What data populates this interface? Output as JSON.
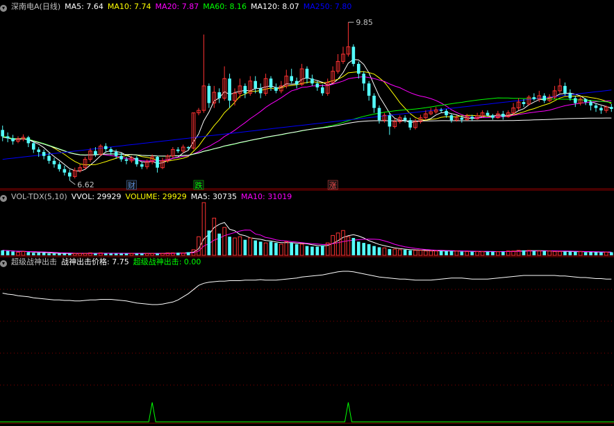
{
  "main_legend": {
    "title": "深南电A(日线)",
    "items": [
      {
        "text": "MA5: 7.64",
        "color": "#ffffff"
      },
      {
        "text": "MA10: 7.74",
        "color": "#ffff00"
      },
      {
        "text": "MA20: 7.87",
        "color": "#ff00ff"
      },
      {
        "text": "MA60: 8.16",
        "color": "#00ff00"
      },
      {
        "text": "MA120: 8.07",
        "color": "#ffffff"
      },
      {
        "text": "MA250: 7.80",
        "color": "#0000ff"
      }
    ]
  },
  "vol_legend": {
    "items": [
      {
        "text": "VOL-TDX(5,10)",
        "color": "#c0c0c0"
      },
      {
        "text": "VVOL: 29929",
        "color": "#ffffff"
      },
      {
        "text": "VOLUME: 29929",
        "color": "#ffff00"
      },
      {
        "text": "MA5: 30735",
        "color": "#ffffff"
      },
      {
        "text": "MA10: 31019",
        "color": "#ff00ff"
      }
    ]
  },
  "ind_legend": {
    "items": [
      {
        "text": "超级战神出击",
        "color": "#c0c0c0"
      },
      {
        "text": "战神出击价格: 7.75",
        "color": "#ffffff"
      },
      {
        "text": "超级战神出击: 0.00",
        "color": "#00ff00"
      }
    ]
  },
  "annotations": {
    "high": "9.85",
    "low": "6.62",
    "events": [
      {
        "label": "财",
        "index": 25,
        "color": "#5b8fd9"
      },
      {
        "label": "跌",
        "index": 38,
        "color": "#00ff00"
      },
      {
        "label": "涨",
        "index": 64,
        "color": "#ff5050"
      }
    ]
  },
  "colors": {
    "up": "#ff3232",
    "down": "#54ffff",
    "grid": "#8b0000",
    "signal": "#00ff00"
  },
  "chart_data": {
    "type": "candlestick",
    "ylim": [
      6.45,
      10.05
    ],
    "candles": [
      [
        7.65,
        7.52,
        7.74,
        7.42
      ],
      [
        7.52,
        7.48,
        7.6,
        7.4
      ],
      [
        7.48,
        7.42,
        7.55,
        7.35
      ],
      [
        7.42,
        7.47,
        7.52,
        7.38
      ],
      [
        7.47,
        7.5,
        7.56,
        7.42
      ],
      [
        7.5,
        7.38,
        7.53,
        7.3
      ],
      [
        7.38,
        7.25,
        7.42,
        7.18
      ],
      [
        7.25,
        7.2,
        7.3,
        7.1
      ],
      [
        7.2,
        7.12,
        7.25,
        7.05
      ],
      [
        7.12,
        7.02,
        7.18,
        6.96
      ],
      [
        7.02,
        6.95,
        7.08,
        6.88
      ],
      [
        6.95,
        6.85,
        7.0,
        6.8
      ],
      [
        6.85,
        6.78,
        6.92,
        6.72
      ],
      [
        6.78,
        6.7,
        6.84,
        6.62
      ],
      [
        6.7,
        6.82,
        6.88,
        6.66
      ],
      [
        6.82,
        6.88,
        6.95,
        6.78
      ],
      [
        6.88,
        7.05,
        7.1,
        6.85
      ],
      [
        7.05,
        7.22,
        7.28,
        7.0
      ],
      [
        7.22,
        7.15,
        7.3,
        7.1
      ],
      [
        7.15,
        7.32,
        7.36,
        7.12
      ],
      [
        7.32,
        7.26,
        7.38,
        7.2
      ],
      [
        7.26,
        7.2,
        7.3,
        7.14
      ],
      [
        7.2,
        7.12,
        7.25,
        7.06
      ],
      [
        7.12,
        7.05,
        7.18,
        7.0
      ],
      [
        7.05,
        7.02,
        7.1,
        6.95
      ],
      [
        7.02,
        7.08,
        7.12,
        6.98
      ],
      [
        7.08,
        6.95,
        7.12,
        6.9
      ],
      [
        6.95,
        6.9,
        7.0,
        6.85
      ],
      [
        6.9,
        7.0,
        7.05,
        6.85
      ],
      [
        7.0,
        7.1,
        7.15,
        6.95
      ],
      [
        7.1,
        6.88,
        7.12,
        6.78
      ],
      [
        6.88,
        7.02,
        7.08,
        6.85
      ],
      [
        7.02,
        7.12,
        7.15,
        6.98
      ],
      [
        7.12,
        7.25,
        7.3,
        7.08
      ],
      [
        7.25,
        7.22,
        7.3,
        7.18
      ],
      [
        7.22,
        7.3,
        7.35,
        7.18
      ],
      [
        7.3,
        7.28,
        7.32,
        7.24
      ],
      [
        7.28,
        8.0,
        8.0,
        7.25
      ],
      [
        8.0,
        8.05,
        8.1,
        7.95
      ],
      [
        8.05,
        8.55,
        9.6,
        8.0
      ],
      [
        8.55,
        8.2,
        8.6,
        8.1
      ],
      [
        8.2,
        8.42,
        8.55,
        8.1
      ],
      [
        8.42,
        8.3,
        8.5,
        8.2
      ],
      [
        8.3,
        8.7,
        8.95,
        8.25
      ],
      [
        8.7,
        8.25,
        8.8,
        8.1
      ],
      [
        8.25,
        8.4,
        8.5,
        8.15
      ],
      [
        8.4,
        8.55,
        8.7,
        8.3
      ],
      [
        8.55,
        8.4,
        8.6,
        8.3
      ],
      [
        8.4,
        8.65,
        8.75,
        8.35
      ],
      [
        8.65,
        8.5,
        8.75,
        8.4
      ],
      [
        8.5,
        8.4,
        8.6,
        8.3
      ],
      [
        8.4,
        8.7,
        8.8,
        8.35
      ],
      [
        8.7,
        8.52,
        8.75,
        8.45
      ],
      [
        8.52,
        8.45,
        8.6,
        8.4
      ],
      [
        8.45,
        8.55,
        8.65,
        8.4
      ],
      [
        8.55,
        8.75,
        8.88,
        8.5
      ],
      [
        8.75,
        8.65,
        8.9,
        8.6
      ],
      [
        8.65,
        8.58,
        8.72,
        8.5
      ],
      [
        8.58,
        8.9,
        9.0,
        8.55
      ],
      [
        8.9,
        8.7,
        8.95,
        8.6
      ],
      [
        8.7,
        8.6,
        8.78,
        8.55
      ],
      [
        8.6,
        8.52,
        8.65,
        8.45
      ],
      [
        8.52,
        8.4,
        8.58,
        8.35
      ],
      [
        8.4,
        8.62,
        8.7,
        8.35
      ],
      [
        8.62,
        8.85,
        8.95,
        8.6
      ],
      [
        8.85,
        9.05,
        9.2,
        8.8
      ],
      [
        9.05,
        9.2,
        9.35,
        9.0
      ],
      [
        9.2,
        9.35,
        9.85,
        9.15
      ],
      [
        9.35,
        9.0,
        9.4,
        8.95
      ],
      [
        9.0,
        8.8,
        9.05,
        8.7
      ],
      [
        8.8,
        8.6,
        8.85,
        8.45
      ],
      [
        8.6,
        8.35,
        8.65,
        8.25
      ],
      [
        8.35,
        8.1,
        8.4,
        8.0
      ],
      [
        8.1,
        7.85,
        8.15,
        7.78
      ],
      [
        7.85,
        7.95,
        8.0,
        7.8
      ],
      [
        7.95,
        7.72,
        8.0,
        7.55
      ],
      [
        7.72,
        7.82,
        7.88,
        7.68
      ],
      [
        7.82,
        7.9,
        7.95,
        7.78
      ],
      [
        7.9,
        7.85,
        7.95,
        7.8
      ],
      [
        7.85,
        7.7,
        7.9,
        7.65
      ],
      [
        7.7,
        7.82,
        7.88,
        7.66
      ],
      [
        7.82,
        7.9,
        7.96,
        7.78
      ],
      [
        7.9,
        7.98,
        8.05,
        7.85
      ],
      [
        7.98,
        8.02,
        8.1,
        7.95
      ],
      [
        8.02,
        8.06,
        8.12,
        7.98
      ],
      [
        8.06,
        8.04,
        8.1,
        8.0
      ],
      [
        8.04,
        7.95,
        8.08,
        7.9
      ],
      [
        7.95,
        7.85,
        7.98,
        7.8
      ],
      [
        7.85,
        7.9,
        7.95,
        7.82
      ],
      [
        7.9,
        7.86,
        7.94,
        7.8
      ],
      [
        7.86,
        7.92,
        7.98,
        7.84
      ],
      [
        7.92,
        7.88,
        7.96,
        7.84
      ],
      [
        7.88,
        7.94,
        8.0,
        7.86
      ],
      [
        7.94,
        8.0,
        8.05,
        7.9
      ],
      [
        8.0,
        7.95,
        8.05,
        7.92
      ],
      [
        7.95,
        7.9,
        7.98,
        7.86
      ],
      [
        7.9,
        7.98,
        8.04,
        7.88
      ],
      [
        7.98,
        7.92,
        8.04,
        7.86
      ],
      [
        7.92,
        8.0,
        8.05,
        7.9
      ],
      [
        8.0,
        8.1,
        8.2,
        7.95
      ],
      [
        8.1,
        8.22,
        8.3,
        8.05
      ],
      [
        8.22,
        8.18,
        8.28,
        8.12
      ],
      [
        8.18,
        8.32,
        8.36,
        8.15
      ],
      [
        8.32,
        8.28,
        8.4,
        8.25
      ],
      [
        8.28,
        8.35,
        8.45,
        8.22
      ],
      [
        8.35,
        8.25,
        8.4,
        8.2
      ],
      [
        8.25,
        8.32,
        8.38,
        8.22
      ],
      [
        8.32,
        8.45,
        8.55,
        8.28
      ],
      [
        8.45,
        8.55,
        8.7,
        8.4
      ],
      [
        8.55,
        8.4,
        8.62,
        8.35
      ],
      [
        8.4,
        8.3,
        8.48,
        8.25
      ],
      [
        8.3,
        8.2,
        8.35,
        8.12
      ],
      [
        8.2,
        8.28,
        8.32,
        8.15
      ],
      [
        8.28,
        8.22,
        8.3,
        8.16
      ],
      [
        8.22,
        8.15,
        8.26,
        8.05
      ],
      [
        8.15,
        8.1,
        8.2,
        8.02
      ],
      [
        8.1,
        8.05,
        8.14,
        7.98
      ],
      [
        8.05,
        8.12,
        8.15,
        8.0
      ],
      [
        8.12,
        8.08,
        8.18,
        8.02
      ]
    ],
    "volume": [
      8,
      7,
      6,
      5,
      6,
      5,
      4,
      4,
      4,
      3,
      3,
      3,
      3,
      3,
      3,
      3,
      3,
      4,
      3,
      4,
      3,
      3,
      3,
      3,
      3,
      3,
      3,
      3,
      3,
      3,
      3,
      3,
      4,
      4,
      4,
      4,
      5,
      9,
      30,
      85,
      40,
      60,
      35,
      45,
      30,
      28,
      30,
      25,
      28,
      24,
      22,
      20,
      22,
      20,
      18,
      22,
      20,
      18,
      18,
      15,
      14,
      14,
      16,
      20,
      32,
      36,
      40,
      30,
      28,
      22,
      20,
      18,
      15,
      13,
      12,
      10,
      10,
      9,
      9,
      8,
      8,
      8,
      7,
      7,
      7,
      7,
      7,
      7,
      7,
      6,
      6,
      6,
      6,
      6,
      6,
      6,
      6,
      6,
      7,
      7,
      8,
      8,
      8,
      7,
      7,
      7,
      7,
      6,
      6,
      6,
      6,
      6,
      6,
      5,
      5,
      5,
      5,
      5,
      5
    ],
    "indicator_price_line": [
      6.75,
      6.73,
      6.72,
      6.7,
      6.69,
      6.68,
      6.66,
      6.65,
      6.64,
      6.63,
      6.62,
      6.62,
      6.61,
      6.61,
      6.6,
      6.6,
      6.61,
      6.62,
      6.62,
      6.63,
      6.63,
      6.63,
      6.62,
      6.61,
      6.6,
      6.58,
      6.56,
      6.55,
      6.54,
      6.53,
      6.53,
      6.54,
      6.56,
      6.58,
      6.62,
      6.68,
      6.74,
      6.82,
      6.9,
      6.94,
      6.96,
      6.97,
      6.98,
      6.98,
      6.99,
      6.99,
      6.99,
      7.0,
      7.0,
      7.0,
      7.01,
      7.0,
      7.0,
      7.0,
      7.01,
      7.02,
      7.03,
      7.04,
      7.06,
      7.07,
      7.08,
      7.09,
      7.1,
      7.12,
      7.14,
      7.16,
      7.17,
      7.17,
      7.16,
      7.14,
      7.12,
      7.1,
      7.08,
      7.06,
      7.05,
      7.04,
      7.03,
      7.02,
      7.02,
      7.01,
      7.0,
      7.0,
      7.0,
      7.0,
      7.01,
      7.02,
      7.03,
      7.04,
      7.04,
      7.04,
      7.03,
      7.02,
      7.02,
      7.02,
      7.02,
      7.03,
      7.04,
      7.05,
      7.06,
      7.07,
      7.08,
      7.09,
      7.09,
      7.09,
      7.09,
      7.09,
      7.09,
      7.09,
      7.08,
      7.08,
      7.07,
      7.06,
      7.05,
      7.05,
      7.04,
      7.03,
      7.03,
      7.02,
      7.02
    ],
    "indicator_signal_index": [
      29,
      67
    ]
  }
}
